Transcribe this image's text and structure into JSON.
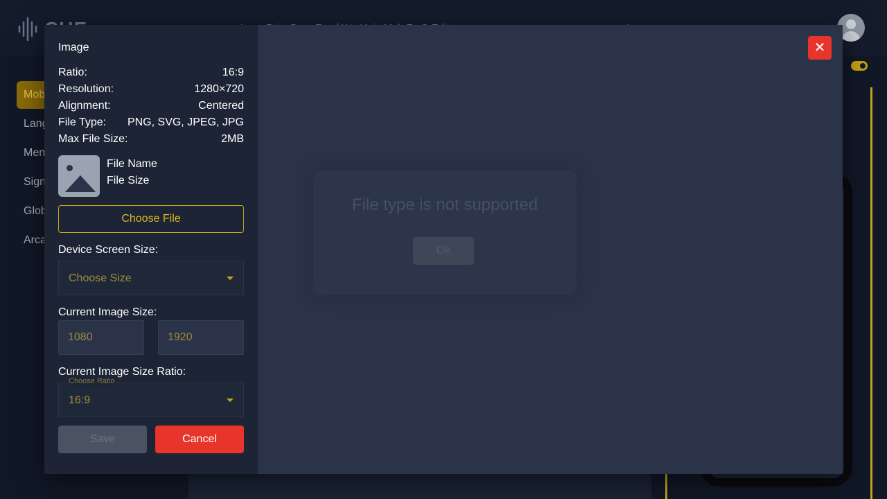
{
  "app": {
    "logo_text": "CUE",
    "nav_partial": "Prim Dum    Zap f Wa    Unis Mak    EwO    Edit"
  },
  "sidebar": {
    "items": [
      {
        "label": "Mob"
      },
      {
        "label": "Lang"
      },
      {
        "label": "Men"
      },
      {
        "label": "Sign"
      },
      {
        "label": "Glob"
      },
      {
        "label": "Arca"
      }
    ]
  },
  "modal": {
    "title": "Image",
    "info": [
      {
        "label": "Ratio:",
        "value": "16:9"
      },
      {
        "label": "Resolution:",
        "value": "1280×720"
      },
      {
        "label": "Alignment:",
        "value": "Centered"
      },
      {
        "label": "File Type:",
        "value": "PNG, SVG, JPEG, JPG"
      },
      {
        "label": "Max File Size:",
        "value": "2MB"
      }
    ],
    "file": {
      "name_label": "File Name",
      "size_label": "File Size"
    },
    "choose_file_label": "Choose File",
    "device_screen_size": {
      "label": "Device Screen Size:",
      "placeholder": "Choose Size"
    },
    "current_image_size": {
      "label": "Current Image Size:",
      "width": "1080",
      "height": "1920"
    },
    "current_ratio": {
      "label": "Current Image Size Ratio:",
      "float_label": "Choose Ratio",
      "value": "16:9"
    },
    "save_label": "Save",
    "cancel_label": "Cancel",
    "close_icon": "close-icon"
  },
  "error_dialog": {
    "message": "File type is not supported",
    "ok_label": "Ok"
  },
  "colors": {
    "accent": "#c9a416",
    "danger": "#e8352b",
    "modal_bg": "#2a3347",
    "pane_bg": "#1c2435"
  }
}
